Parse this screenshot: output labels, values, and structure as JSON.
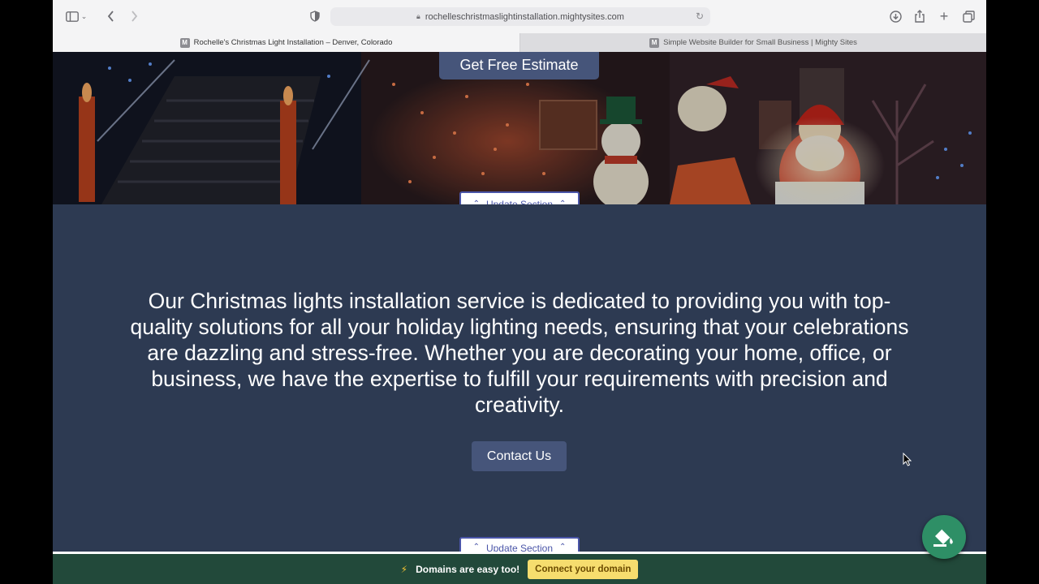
{
  "browser": {
    "url": "rochelleschristmaslightinstallation.mightysites.com",
    "tabs": [
      {
        "label": "Rochelle's Christmas Light Installation – Denver, Colorado",
        "favicon": "M"
      },
      {
        "label": "Simple Website Builder for Small Business | Mighty Sites",
        "favicon": "M"
      }
    ],
    "icons": [
      "sidebar-icon",
      "back-icon",
      "forward-icon",
      "shield-icon",
      "lock-icon",
      "reload-icon",
      "download-icon",
      "share-icon",
      "new-tab-icon",
      "tab-overview-icon"
    ]
  },
  "hero": {
    "estimate_label": "Get Free Estimate"
  },
  "section": {
    "update_label": "Update Section",
    "text": "Our Christmas lights installation service is dedicated to providing you with top-quality solutions for all your holiday lighting needs, ensuring that your celebrations are dazzling and stress-free. Whether you are decorating your home, office, or business, we have the expertise to fulfill your requirements with precision and creativity.",
    "contact_label": "Contact Us",
    "background": "#2d3a52"
  },
  "banner": {
    "message": "Domains are easy too!",
    "cta_label": "Connect your domain",
    "background": "#22493a",
    "cta_color": "#f6dd6e"
  },
  "fab": {
    "icon": "paint-bucket-icon",
    "color": "#2e8f66"
  }
}
